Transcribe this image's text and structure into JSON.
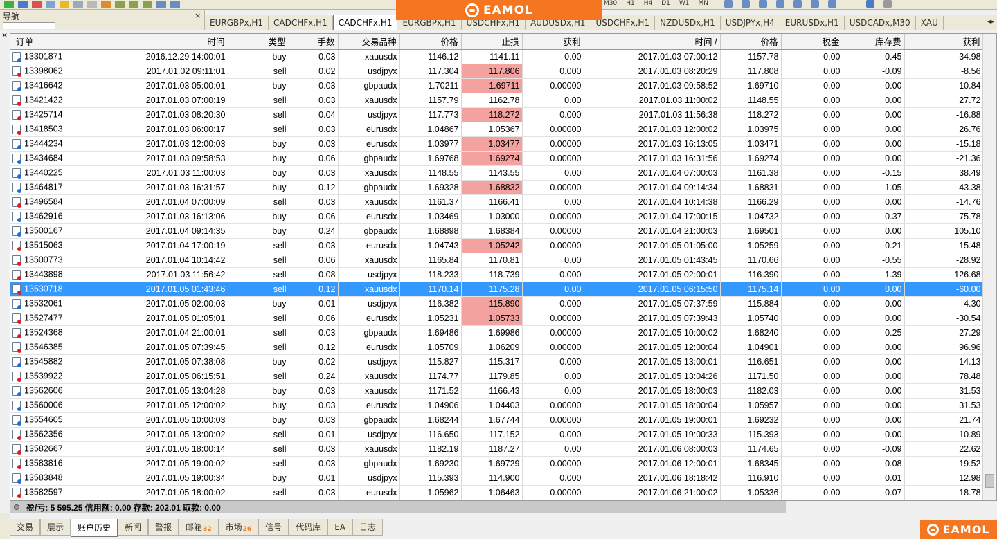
{
  "brand": {
    "name": "EAMOL"
  },
  "toolbar": {
    "timeframes": [
      "M30",
      "H1",
      "H4",
      "D1",
      "W1",
      "MN"
    ]
  },
  "navigator": {
    "title": "导航",
    "close": "×"
  },
  "chart_tabs": [
    "EURGBPx,H1",
    "CADCHFx,H1",
    "CADCHFx,H1",
    "EURGBPx,H1",
    "USDCHFx,H1",
    "AUDUSDx,H1",
    "USDCHFx,H1",
    "NZDUSDx,H1",
    "USDJPYx,H4",
    "EURUSDx,H1",
    "USDCADx,M30",
    "XAU"
  ],
  "table": {
    "columns": [
      "订单",
      "时间",
      "类型",
      "手数",
      "交易品种",
      "价格",
      "止损",
      "获利",
      "时间 /",
      "价格",
      "税金",
      "库存费",
      "获利"
    ],
    "rows": [
      {
        "order": "13301871",
        "open_time": "2016.12.29 14:00:01",
        "type": "buy",
        "lots": "0.03",
        "symbol": "xauusdx",
        "open_price": "1146.12",
        "sl": "1141.11",
        "tp": "0.00",
        "close_time": "2017.01.03 07:00:12",
        "close_price": "1157.78",
        "tax": "0.00",
        "swap": "-0.45",
        "profit": "34.98",
        "sl_hit": false
      },
      {
        "order": "13398062",
        "open_time": "2017.01.02 09:11:01",
        "type": "sell",
        "lots": "0.02",
        "symbol": "usdjpyx",
        "open_price": "117.304",
        "sl": "117.806",
        "tp": "0.000",
        "close_time": "2017.01.03 08:20:29",
        "close_price": "117.808",
        "tax": "0.00",
        "swap": "-0.09",
        "profit": "-8.56",
        "sl_hit": true
      },
      {
        "order": "13416642",
        "open_time": "2017.01.03 05:00:01",
        "type": "buy",
        "lots": "0.03",
        "symbol": "gbpaudx",
        "open_price": "1.70211",
        "sl": "1.69711",
        "tp": "0.00000",
        "close_time": "2017.01.03 09:58:52",
        "close_price": "1.69710",
        "tax": "0.00",
        "swap": "0.00",
        "profit": "-10.84",
        "sl_hit": true
      },
      {
        "order": "13421422",
        "open_time": "2017.01.03 07:00:19",
        "type": "sell",
        "lots": "0.03",
        "symbol": "xauusdx",
        "open_price": "1157.79",
        "sl": "1162.78",
        "tp": "0.00",
        "close_time": "2017.01.03 11:00:02",
        "close_price": "1148.55",
        "tax": "0.00",
        "swap": "0.00",
        "profit": "27.72",
        "sl_hit": false
      },
      {
        "order": "13425714",
        "open_time": "2017.01.03 08:20:30",
        "type": "sell",
        "lots": "0.04",
        "symbol": "usdjpyx",
        "open_price": "117.773",
        "sl": "118.272",
        "tp": "0.000",
        "close_time": "2017.01.03 11:56:38",
        "close_price": "118.272",
        "tax": "0.00",
        "swap": "0.00",
        "profit": "-16.88",
        "sl_hit": true
      },
      {
        "order": "13418503",
        "open_time": "2017.01.03 06:00:17",
        "type": "sell",
        "lots": "0.03",
        "symbol": "eurusdx",
        "open_price": "1.04867",
        "sl": "1.05367",
        "tp": "0.00000",
        "close_time": "2017.01.03 12:00:02",
        "close_price": "1.03975",
        "tax": "0.00",
        "swap": "0.00",
        "profit": "26.76",
        "sl_hit": false
      },
      {
        "order": "13444234",
        "open_time": "2017.01.03 12:00:03",
        "type": "buy",
        "lots": "0.03",
        "symbol": "eurusdx",
        "open_price": "1.03977",
        "sl": "1.03477",
        "tp": "0.00000",
        "close_time": "2017.01.03 16:13:05",
        "close_price": "1.03471",
        "tax": "0.00",
        "swap": "0.00",
        "profit": "-15.18",
        "sl_hit": true
      },
      {
        "order": "13434684",
        "open_time": "2017.01.03 09:58:53",
        "type": "buy",
        "lots": "0.06",
        "symbol": "gbpaudx",
        "open_price": "1.69768",
        "sl": "1.69274",
        "tp": "0.00000",
        "close_time": "2017.01.03 16:31:56",
        "close_price": "1.69274",
        "tax": "0.00",
        "swap": "0.00",
        "profit": "-21.36",
        "sl_hit": true
      },
      {
        "order": "13440225",
        "open_time": "2017.01.03 11:00:03",
        "type": "buy",
        "lots": "0.03",
        "symbol": "xauusdx",
        "open_price": "1148.55",
        "sl": "1143.55",
        "tp": "0.00",
        "close_time": "2017.01.04 07:00:03",
        "close_price": "1161.38",
        "tax": "0.00",
        "swap": "-0.15",
        "profit": "38.49",
        "sl_hit": false
      },
      {
        "order": "13464817",
        "open_time": "2017.01.03 16:31:57",
        "type": "buy",
        "lots": "0.12",
        "symbol": "gbpaudx",
        "open_price": "1.69328",
        "sl": "1.68832",
        "tp": "0.00000",
        "close_time": "2017.01.04 09:14:34",
        "close_price": "1.68831",
        "tax": "0.00",
        "swap": "-1.05",
        "profit": "-43.38",
        "sl_hit": true
      },
      {
        "order": "13496584",
        "open_time": "2017.01.04 07:00:09",
        "type": "sell",
        "lots": "0.03",
        "symbol": "xauusdx",
        "open_price": "1161.37",
        "sl": "1166.41",
        "tp": "0.00",
        "close_time": "2017.01.04 10:14:38",
        "close_price": "1166.29",
        "tax": "0.00",
        "swap": "0.00",
        "profit": "-14.76",
        "sl_hit": false
      },
      {
        "order": "13462916",
        "open_time": "2017.01.03 16:13:06",
        "type": "buy",
        "lots": "0.06",
        "symbol": "eurusdx",
        "open_price": "1.03469",
        "sl": "1.03000",
        "tp": "0.00000",
        "close_time": "2017.01.04 17:00:15",
        "close_price": "1.04732",
        "tax": "0.00",
        "swap": "-0.37",
        "profit": "75.78",
        "sl_hit": false
      },
      {
        "order": "13500167",
        "open_time": "2017.01.04 09:14:35",
        "type": "buy",
        "lots": "0.24",
        "symbol": "gbpaudx",
        "open_price": "1.68898",
        "sl": "1.68384",
        "tp": "0.00000",
        "close_time": "2017.01.04 21:00:03",
        "close_price": "1.69501",
        "tax": "0.00",
        "swap": "0.00",
        "profit": "105.10",
        "sl_hit": false
      },
      {
        "order": "13515063",
        "open_time": "2017.01.04 17:00:19",
        "type": "sell",
        "lots": "0.03",
        "symbol": "eurusdx",
        "open_price": "1.04743",
        "sl": "1.05242",
        "tp": "0.00000",
        "close_time": "2017.01.05 01:05:00",
        "close_price": "1.05259",
        "tax": "0.00",
        "swap": "0.21",
        "profit": "-15.48",
        "sl_hit": true
      },
      {
        "order": "13500773",
        "open_time": "2017.01.04 10:14:42",
        "type": "sell",
        "lots": "0.06",
        "symbol": "xauusdx",
        "open_price": "1165.84",
        "sl": "1170.81",
        "tp": "0.00",
        "close_time": "2017.01.05 01:43:45",
        "close_price": "1170.66",
        "tax": "0.00",
        "swap": "-0.55",
        "profit": "-28.92",
        "sl_hit": false
      },
      {
        "order": "13443898",
        "open_time": "2017.01.03 11:56:42",
        "type": "sell",
        "lots": "0.08",
        "symbol": "usdjpyx",
        "open_price": "118.233",
        "sl": "118.739",
        "tp": "0.000",
        "close_time": "2017.01.05 02:00:01",
        "close_price": "116.390",
        "tax": "0.00",
        "swap": "-1.39",
        "profit": "126.68",
        "sl_hit": false
      },
      {
        "order": "13530718",
        "open_time": "2017.01.05 01:43:46",
        "type": "sell",
        "lots": "0.12",
        "symbol": "xauusdx",
        "open_price": "1170.14",
        "sl": "1175.28",
        "tp": "0.00",
        "close_time": "2017.01.05 06:15:50",
        "close_price": "1175.14",
        "tax": "0.00",
        "swap": "0.00",
        "profit": "-60.00",
        "sl_hit": false,
        "selected": true
      },
      {
        "order": "13532061",
        "open_time": "2017.01.05 02:00:03",
        "type": "buy",
        "lots": "0.01",
        "symbol": "usdjpyx",
        "open_price": "116.382",
        "sl": "115.890",
        "tp": "0.000",
        "close_time": "2017.01.05 07:37:59",
        "close_price": "115.884",
        "tax": "0.00",
        "swap": "0.00",
        "profit": "-4.30",
        "sl_hit": true
      },
      {
        "order": "13527477",
        "open_time": "2017.01.05 01:05:01",
        "type": "sell",
        "lots": "0.06",
        "symbol": "eurusdx",
        "open_price": "1.05231",
        "sl": "1.05733",
        "tp": "0.00000",
        "close_time": "2017.01.05 07:39:43",
        "close_price": "1.05740",
        "tax": "0.00",
        "swap": "0.00",
        "profit": "-30.54",
        "sl_hit": true
      },
      {
        "order": "13524368",
        "open_time": "2017.01.04 21:00:01",
        "type": "sell",
        "lots": "0.03",
        "symbol": "gbpaudx",
        "open_price": "1.69486",
        "sl": "1.69986",
        "tp": "0.00000",
        "close_time": "2017.01.05 10:00:02",
        "close_price": "1.68240",
        "tax": "0.00",
        "swap": "0.25",
        "profit": "27.29",
        "sl_hit": false
      },
      {
        "order": "13546385",
        "open_time": "2017.01.05 07:39:45",
        "type": "sell",
        "lots": "0.12",
        "symbol": "eurusdx",
        "open_price": "1.05709",
        "sl": "1.06209",
        "tp": "0.00000",
        "close_time": "2017.01.05 12:00:04",
        "close_price": "1.04901",
        "tax": "0.00",
        "swap": "0.00",
        "profit": "96.96",
        "sl_hit": false
      },
      {
        "order": "13545882",
        "open_time": "2017.01.05 07:38:08",
        "type": "buy",
        "lots": "0.02",
        "symbol": "usdjpyx",
        "open_price": "115.827",
        "sl": "115.317",
        "tp": "0.000",
        "close_time": "2017.01.05 13:00:01",
        "close_price": "116.651",
        "tax": "0.00",
        "swap": "0.00",
        "profit": "14.13",
        "sl_hit": false
      },
      {
        "order": "13539922",
        "open_time": "2017.01.05 06:15:51",
        "type": "sell",
        "lots": "0.24",
        "symbol": "xauusdx",
        "open_price": "1174.77",
        "sl": "1179.85",
        "tp": "0.00",
        "close_time": "2017.01.05 13:04:26",
        "close_price": "1171.50",
        "tax": "0.00",
        "swap": "0.00",
        "profit": "78.48",
        "sl_hit": false
      },
      {
        "order": "13562606",
        "open_time": "2017.01.05 13:04:28",
        "type": "buy",
        "lots": "0.03",
        "symbol": "xauusdx",
        "open_price": "1171.52",
        "sl": "1166.43",
        "tp": "0.00",
        "close_time": "2017.01.05 18:00:03",
        "close_price": "1182.03",
        "tax": "0.00",
        "swap": "0.00",
        "profit": "31.53",
        "sl_hit": false
      },
      {
        "order": "13560006",
        "open_time": "2017.01.05 12:00:02",
        "type": "buy",
        "lots": "0.03",
        "symbol": "eurusdx",
        "open_price": "1.04906",
        "sl": "1.04403",
        "tp": "0.00000",
        "close_time": "2017.01.05 18:00:04",
        "close_price": "1.05957",
        "tax": "0.00",
        "swap": "0.00",
        "profit": "31.53",
        "sl_hit": false
      },
      {
        "order": "13554605",
        "open_time": "2017.01.05 10:00:03",
        "type": "buy",
        "lots": "0.03",
        "symbol": "gbpaudx",
        "open_price": "1.68244",
        "sl": "1.67744",
        "tp": "0.00000",
        "close_time": "2017.01.05 19:00:01",
        "close_price": "1.69232",
        "tax": "0.00",
        "swap": "0.00",
        "profit": "21.74",
        "sl_hit": false
      },
      {
        "order": "13562356",
        "open_time": "2017.01.05 13:00:02",
        "type": "sell",
        "lots": "0.01",
        "symbol": "usdjpyx",
        "open_price": "116.650",
        "sl": "117.152",
        "tp": "0.000",
        "close_time": "2017.01.05 19:00:33",
        "close_price": "115.393",
        "tax": "0.00",
        "swap": "0.00",
        "profit": "10.89",
        "sl_hit": false
      },
      {
        "order": "13582667",
        "open_time": "2017.01.05 18:00:14",
        "type": "sell",
        "lots": "0.03",
        "symbol": "xauusdx",
        "open_price": "1182.19",
        "sl": "1187.27",
        "tp": "0.00",
        "close_time": "2017.01.06 08:00:03",
        "close_price": "1174.65",
        "tax": "0.00",
        "swap": "-0.09",
        "profit": "22.62",
        "sl_hit": false
      },
      {
        "order": "13583816",
        "open_time": "2017.01.05 19:00:02",
        "type": "sell",
        "lots": "0.03",
        "symbol": "gbpaudx",
        "open_price": "1.69230",
        "sl": "1.69729",
        "tp": "0.00000",
        "close_time": "2017.01.06 12:00:01",
        "close_price": "1.68345",
        "tax": "0.00",
        "swap": "0.08",
        "profit": "19.52",
        "sl_hit": false
      },
      {
        "order": "13583848",
        "open_time": "2017.01.05 19:00:34",
        "type": "buy",
        "lots": "0.01",
        "symbol": "usdjpyx",
        "open_price": "115.393",
        "sl": "114.900",
        "tp": "0.000",
        "close_time": "2017.01.06 18:18:42",
        "close_price": "116.910",
        "tax": "0.00",
        "swap": "0.01",
        "profit": "12.98",
        "sl_hit": false
      },
      {
        "order": "13582597",
        "open_time": "2017.01.05 18:00:02",
        "type": "sell",
        "lots": "0.03",
        "symbol": "eurusdx",
        "open_price": "1.05962",
        "sl": "1.06463",
        "tp": "0.00000",
        "close_time": "2017.01.06 21:00:02",
        "close_price": "1.05336",
        "tax": "0.00",
        "swap": "0.07",
        "profit": "18.78",
        "sl_hit": false
      }
    ]
  },
  "summary": {
    "text": "盈/亏: 5 595.25  信用额: 0.00  存款: 202.01  取款: 0.00"
  },
  "bottom_tabs": [
    {
      "label": "交易"
    },
    {
      "label": "展示"
    },
    {
      "label": "账户历史",
      "active": true
    },
    {
      "label": "新闻"
    },
    {
      "label": "警报"
    },
    {
      "label": "邮箱",
      "badge": "32"
    },
    {
      "label": "市场",
      "badge": "26"
    },
    {
      "label": "信号"
    },
    {
      "label": "代码库"
    },
    {
      "label": "EA"
    },
    {
      "label": "日志"
    }
  ],
  "colors": {
    "accent": "#f47621",
    "selected_row": "#3399ff",
    "stop_loss_hit": "#f4a2a0"
  }
}
